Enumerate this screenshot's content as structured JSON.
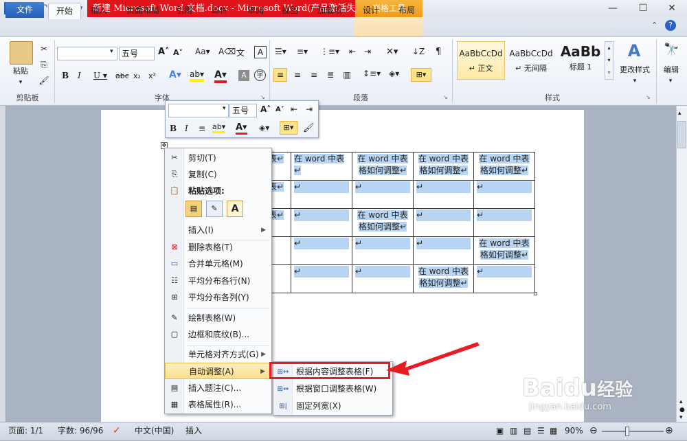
{
  "titlebar": {
    "title": "新建 Microsoft Word 文档.docx - Microsoft Word(产品激活失败)",
    "contextual_tab": "表格工具",
    "minimize": "—",
    "maximize": "☐",
    "close": "✕"
  },
  "tabs": [
    "文件",
    "开始",
    "插入",
    "页面布局",
    "引用",
    "邮件",
    "审阅",
    "视图",
    "加载项",
    "设计",
    "布局"
  ],
  "ribbon": {
    "clipboard": {
      "paste": "粘贴",
      "group": "剪贴板"
    },
    "font": {
      "font_name": "",
      "font_size": "五号",
      "group": "字体"
    },
    "paragraph": {
      "group": "段落"
    },
    "styles": {
      "group": "样式",
      "items": [
        {
          "preview": "AaBbCcDd",
          "name": "↵ 正文"
        },
        {
          "preview": "AaBbCcDd",
          "name": "↵ 无间隔"
        },
        {
          "preview": "AaBb",
          "name": "标题 1"
        }
      ],
      "change_styles": "更改样式"
    },
    "editing": {
      "label": "编辑"
    }
  },
  "mini_toolbar": {
    "font_size": "五号"
  },
  "table": {
    "cell_text": "在 word 中表格如何调整↵",
    "cell_text_short": "在 word 中表↵",
    "frag_1": "表↵",
    "empty": "↵"
  },
  "context_menu": {
    "items": [
      {
        "icon": "scissors-icon",
        "label": "剪切(T)"
      },
      {
        "icon": "copy-icon",
        "label": "复制(C)"
      },
      {
        "icon": "paste-icon",
        "label": "粘贴选项:",
        "bold": true
      },
      {
        "icon": "",
        "label": "插入(I)",
        "submenu": true
      },
      {
        "icon": "delete-table-icon",
        "label": "删除表格(T)"
      },
      {
        "icon": "merge-cells-icon",
        "label": "合并单元格(M)"
      },
      {
        "icon": "distribute-rows-icon",
        "label": "平均分布各行(N)"
      },
      {
        "icon": "distribute-columns-icon",
        "label": "平均分布各列(Y)"
      },
      {
        "icon": "draw-table-icon",
        "label": "绘制表格(W)"
      },
      {
        "icon": "borders-shading-icon",
        "label": "边框和底纹(B)..."
      },
      {
        "icon": "",
        "label": "单元格对齐方式(G)",
        "submenu": true
      },
      {
        "icon": "",
        "label": "自动调整(A)",
        "submenu": true,
        "active": true
      },
      {
        "icon": "insert-caption-icon",
        "label": "插入题注(C)..."
      },
      {
        "icon": "table-properties-icon",
        "label": "表格属性(R)..."
      }
    ]
  },
  "autofit_submenu": {
    "items": [
      {
        "label": "根据内容调整表格(F)"
      },
      {
        "label": "根据窗口调整表格(W)"
      },
      {
        "label": "固定列宽(X)"
      }
    ]
  },
  "statusbar": {
    "page": "页面: 1/1",
    "words": "字数: 96/96",
    "language": "中文(中国)",
    "mode": "插入",
    "zoom": "90%"
  },
  "watermark": {
    "brand": "Baidu",
    "label": "经验",
    "url": "jingyan.baidu.com"
  }
}
